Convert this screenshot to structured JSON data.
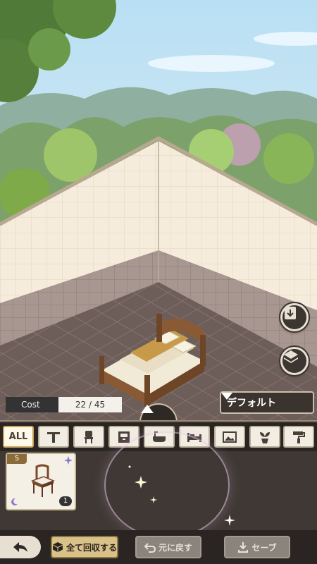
{
  "cost": {
    "label": "Cost",
    "value": "22 / 45"
  },
  "preset": {
    "label": "デフォルト"
  },
  "tabs": [
    {
      "name": "tab-all",
      "label": "ALL",
      "icon": "all"
    },
    {
      "name": "tab-table",
      "icon": "table-icon"
    },
    {
      "name": "tab-chair",
      "icon": "chair-icon"
    },
    {
      "name": "tab-cabinet",
      "icon": "cabinet-icon"
    },
    {
      "name": "tab-bath",
      "icon": "bathtub-icon"
    },
    {
      "name": "tab-bed",
      "icon": "bed-icon"
    },
    {
      "name": "tab-picture",
      "icon": "picture-icon"
    },
    {
      "name": "tab-plant",
      "icon": "plant-icon"
    },
    {
      "name": "tab-paint",
      "icon": "paint-roller-icon"
    }
  ],
  "inventory": [
    {
      "name": "chair",
      "cost": "5",
      "count": "1"
    }
  ],
  "footer": {
    "collect_all": "全て回収する",
    "undo": "元に戻す",
    "save": "セーブ"
  },
  "colors": {
    "accent": "#c8a45c",
    "panel": "#3a332f"
  }
}
